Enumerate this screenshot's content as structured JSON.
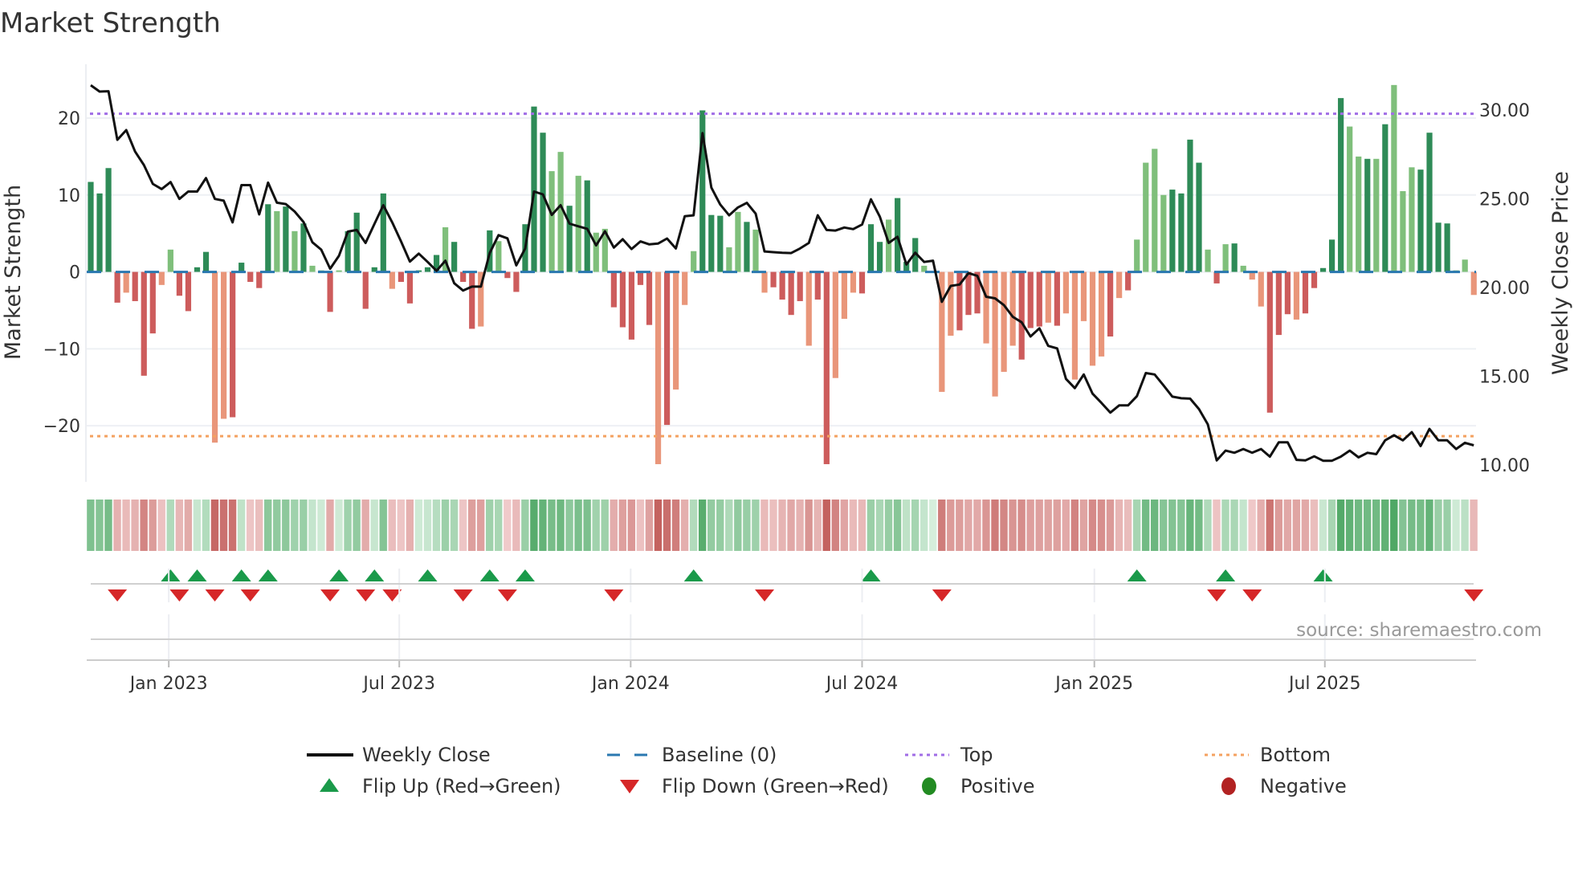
{
  "chart_data": {
    "type": "bar",
    "title": "Market Strength",
    "ylabel": "Market Strength",
    "y2label": "Weekly Close Price",
    "ylim": [
      -27.3,
      27
    ],
    "y2lim": [
      9.05,
      32.58
    ],
    "yticks": [
      20,
      10,
      0,
      -10,
      -20
    ],
    "yticklabels": [
      "20",
      "10",
      "0",
      "−10",
      "−20"
    ],
    "y2ticks": [
      30,
      25,
      20,
      15,
      10
    ],
    "y2ticklabels": [
      "30.00",
      "25.00",
      "20.00",
      "15.00",
      "10.00"
    ],
    "xticks": [
      {
        "pos": 9.8,
        "label": "Jan 2023"
      },
      {
        "pos": 35.8,
        "label": "Jul 2023"
      },
      {
        "pos": 61.9,
        "label": "Jan 2024"
      },
      {
        "pos": 88,
        "label": "Jul 2024"
      },
      {
        "pos": 114.2,
        "label": "Jan 2025"
      },
      {
        "pos": 140.2,
        "label": "Jul 2025"
      }
    ],
    "top_level": 20.56,
    "bottom_level": -21.36,
    "baseline": 0,
    "strength": [
      11.7,
      10.2,
      13.5,
      -4,
      -2.7,
      -3.8,
      -13.5,
      -8,
      -1.7,
      2.9,
      -3.1,
      -5.1,
      0.6,
      2.6,
      -22.2,
      -19.1,
      -18.9,
      1.2,
      -1.3,
      -2.1,
      8.8,
      7.9,
      8.5,
      5.3,
      6.3,
      0.8,
      0.2,
      -5.2,
      0.2,
      5.3,
      7.7,
      -4.8,
      0.6,
      10.2,
      -2.2,
      -1.3,
      -4.1,
      0.2,
      0.6,
      2.2,
      5.8,
      3.9,
      -1.3,
      -7.4,
      -7.1,
      5.4,
      4.0,
      -0.8,
      -2.6,
      6.2,
      21.5,
      18.1,
      13.1,
      15.6,
      8.6,
      12.5,
      11.9,
      5.1,
      5.6,
      -4.6,
      -7.2,
      -8.8,
      -1.7,
      -6.9,
      -25,
      -19.9,
      -15.3,
      -4.3,
      2.7,
      21,
      7.4,
      7.3,
      3.2,
      7.8,
      6.5,
      5.5,
      -2.7,
      -2.0,
      -3.6,
      -5.6,
      -3.8,
      -9.6,
      -3.6,
      -25,
      -13.8,
      -6.1,
      -2.7,
      -2.8,
      6.2,
      3.9,
      6.8,
      9.6,
      1.3,
      4.4,
      0.8,
      0,
      -15.6,
      -8.3,
      -7.6,
      -5.6,
      -5.4,
      -9.3,
      -16.2,
      -13,
      -9.6,
      -11.4,
      -7.3,
      -7.1,
      -6.6,
      -7,
      -5.4,
      -14,
      -6.4,
      -12.2,
      -11,
      -8.4,
      -3.4,
      -2.4,
      4.2,
      14.2,
      16,
      10,
      10.7,
      10.2,
      17.2,
      14.2,
      2.9,
      -1.5,
      3.6,
      3.7,
      0.8,
      -1.0,
      -4.5,
      -18.3,
      -8.2,
      -5.5,
      -6.2,
      -5.4,
      -2.1,
      0.5,
      4.2,
      22.6,
      18.9,
      15,
      14.7,
      14.7,
      19.2,
      24.3,
      10.5,
      13.6,
      13.3,
      18.1,
      6.4,
      6.3,
      0.2,
      1.6,
      -3
    ],
    "strong": "ddddldddllddddlldddddldldlldldddddldddddldddldldddddlldldlldddddldllldddlldllddddlddllldddldddldlldddlllldddldllllldldllllddddldldllldddldddddlldldlllddddllldddddldldllld",
    "close": [
      31.4,
      31.04,
      31.06,
      28.32,
      28.87,
      27.66,
      26.9,
      25.84,
      25.55,
      25.94,
      24.99,
      25.41,
      25.41,
      26.17,
      24.99,
      24.89,
      23.67,
      25.77,
      25.77,
      24.12,
      25.91,
      24.78,
      24.7,
      24.28,
      23.69,
      22.55,
      22.13,
      21.06,
      21.79,
      23.15,
      23.24,
      22.51,
      23.59,
      24.64,
      23.67,
      22.6,
      21.46,
      21.91,
      21.44,
      20.94,
      21.51,
      20.24,
      19.83,
      20.05,
      20.05,
      21.94,
      22.95,
      22.77,
      21.25,
      22.2,
      25.41,
      25.25,
      24.09,
      24.64,
      23.6,
      23.45,
      23.31,
      22.37,
      23.17,
      22.25,
      22.72,
      22.17,
      22.6,
      22.43,
      22.48,
      22.76,
      22.2,
      24.02,
      24.07,
      28.7,
      25.63,
      24.68,
      24.07,
      24.51,
      24.77,
      24.16,
      22.03,
      21.99,
      21.96,
      21.94,
      22.2,
      22.51,
      24.07,
      23.24,
      23.21,
      23.38,
      23.29,
      23.55,
      24.97,
      23.99,
      22.51,
      22.86,
      21.3,
      21.96,
      21.44,
      21.51,
      19.19,
      20.09,
      20.17,
      20.81,
      20.66,
      19.48,
      19.39,
      19.01,
      18.35,
      18.04,
      17.24,
      17.7,
      16.71,
      16.57,
      14.85,
      14.33,
      15.1,
      14.02,
      13.5,
      12.95,
      13.36,
      13.36,
      13.88,
      15.18,
      15.1,
      14.49,
      13.85,
      13.76,
      13.74,
      13.15,
      12.29,
      10.26,
      10.81,
      10.69,
      10.9,
      10.69,
      10.9,
      10.47,
      11.28,
      11.28,
      10.29,
      10.26,
      10.49,
      10.24,
      10.24,
      10.47,
      10.81,
      10.43,
      10.69,
      10.61,
      11.39,
      11.68,
      11.39,
      11.85,
      11.07,
      12.03,
      11.39,
      11.39,
      10.9,
      11.25,
      11.11
    ],
    "flip_up": [
      10,
      13,
      18,
      21,
      29,
      33,
      39,
      46,
      50,
      69,
      89,
      119,
      129,
      140
    ],
    "flip_down": [
      4,
      11,
      15,
      19,
      28,
      32,
      35,
      43,
      48,
      60,
      77,
      97,
      128,
      132,
      157
    ],
    "legend": [
      {
        "label": "Weekly Close",
        "symbol": "line",
        "color": "#111111"
      },
      {
        "label": "Baseline (0)",
        "symbol": "dash",
        "color": "#2a78b0"
      },
      {
        "label": "Top",
        "symbol": "dot",
        "color": "#a06de6"
      },
      {
        "label": "Bottom",
        "symbol": "dot",
        "color": "#f4a261"
      },
      {
        "label": "Flip Up (Red→Green)",
        "symbol": "tri-up",
        "color": "#1a9a4a"
      },
      {
        "label": "Flip Down (Green→Red)",
        "symbol": "tri-down",
        "color": "#d62728"
      },
      {
        "label": "Positive",
        "symbol": "circle",
        "color": "#228b22"
      },
      {
        "label": "Negative",
        "symbol": "circle",
        "color": "#b22222"
      }
    ],
    "legend_placement": "bottom",
    "source": "source: sharemaestro.com"
  },
  "colors": {
    "pos_strong": "#2e8b57",
    "pos_weak": "#7fbf7b",
    "neg_strong": "#cd5c5c",
    "neg_weak": "#e9967a",
    "grid": "#eef0f4",
    "axis": "#cccccc"
  }
}
